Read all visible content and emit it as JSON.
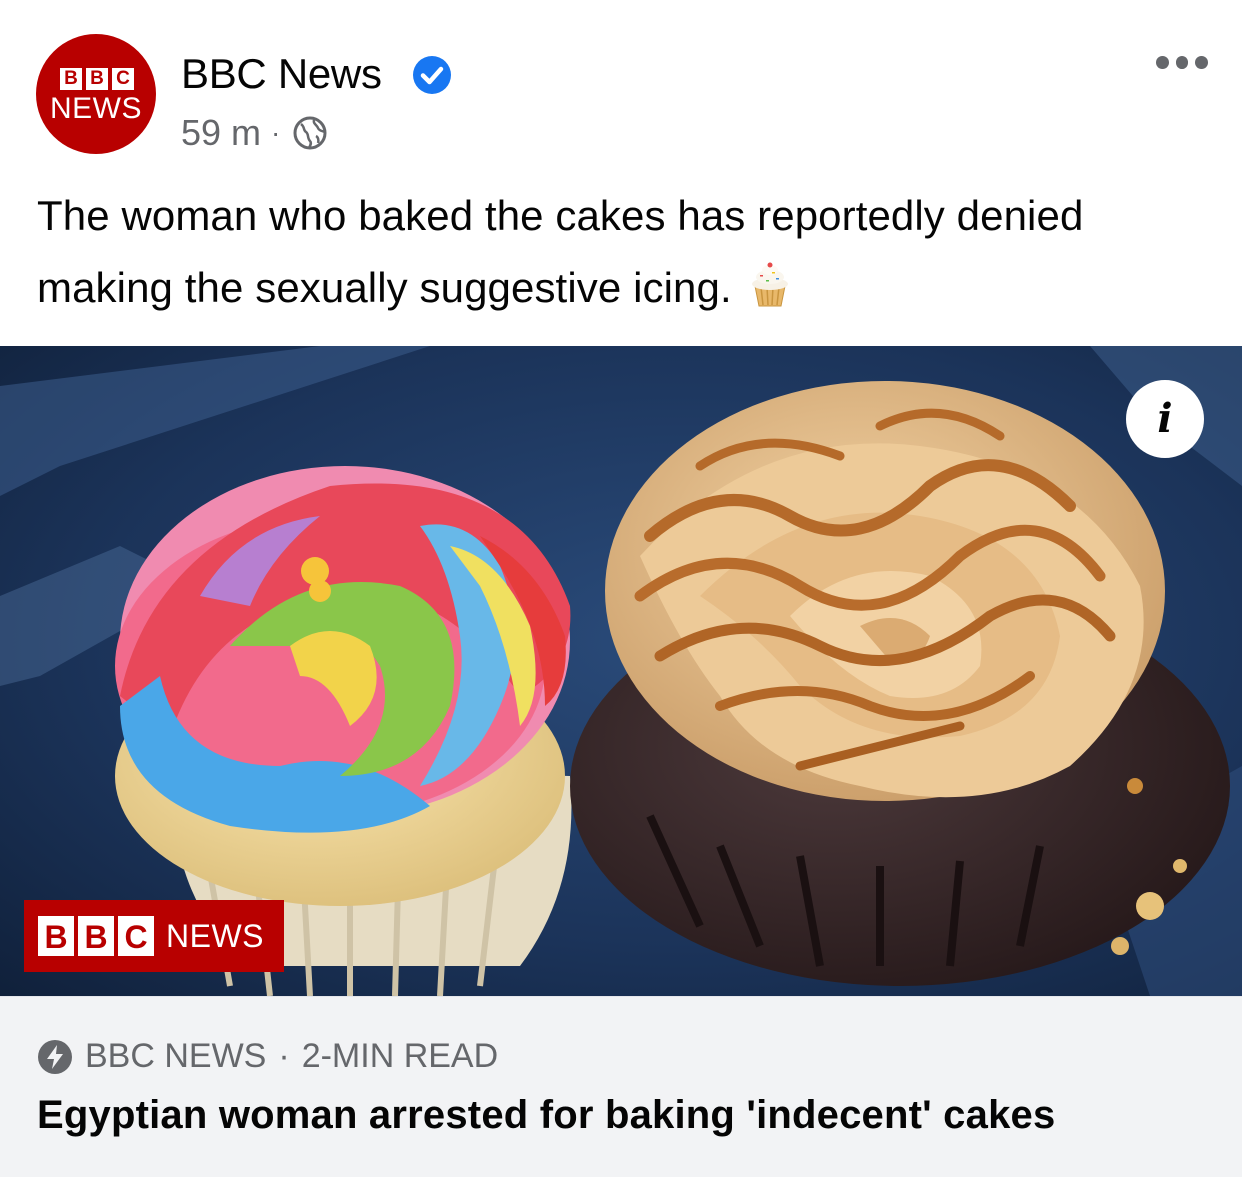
{
  "post": {
    "page_name": "BBC News",
    "avatar": {
      "logo_letters": [
        "B",
        "B",
        "C"
      ],
      "logo_word": "NEWS",
      "color": "#b80000"
    },
    "verified_icon": "verified-badge-icon",
    "time": "59 m",
    "separator": "·",
    "audience_icon": "globe-icon",
    "more_icon": "more-options-icon",
    "text_line1": "The woman who baked the cakes has reportedly denied",
    "text_line2": "making the sexually suggestive icing.",
    "emoji": "cupcake"
  },
  "link": {
    "image_alt_icon": "info-icon",
    "info_label": "i",
    "badge": {
      "letters": [
        "B",
        "B",
        "C"
      ],
      "word": "NEWS"
    },
    "source_icon": "lightning-bolt-icon",
    "source": "BBC NEWS",
    "separator": "·",
    "read_time": "2-MIN READ",
    "headline": "Egyptian woman arrested for baking 'indecent' cakes"
  },
  "colors": {
    "brand_red": "#b80000",
    "verified_blue": "#1877f2",
    "secondary_text": "#65676b",
    "footer_bg": "#f2f3f5"
  }
}
